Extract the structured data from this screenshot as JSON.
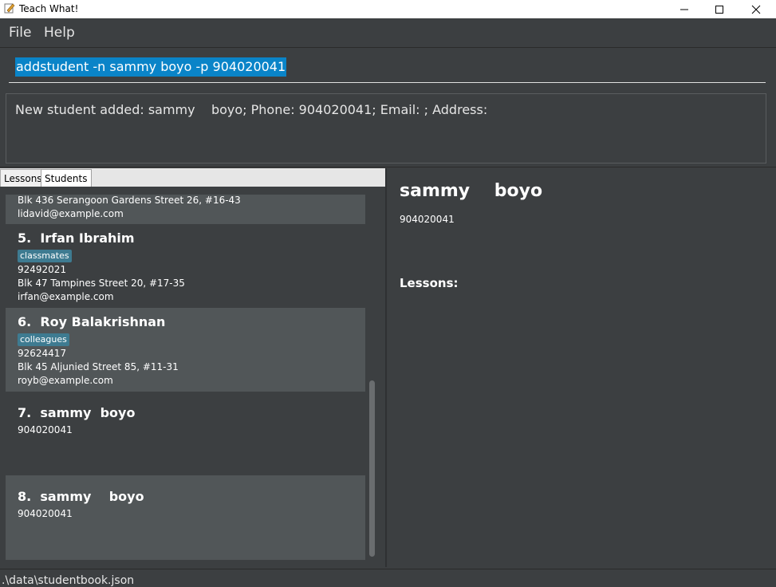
{
  "window": {
    "title": "Teach What!"
  },
  "menu": {
    "file": "File",
    "help": "Help"
  },
  "command": {
    "value": "addstudent -n sammy  boyo -p 904020041"
  },
  "result": {
    "text": "New student added: sammy    boyo; Phone: 904020041; Email: ; Address:"
  },
  "tabs": {
    "lessons": "Lessons",
    "students": "Students"
  },
  "students": [
    {
      "address": "Blk 436 Serangoon Gardens Street 26, #16-43",
      "email": "lidavid@example.com"
    },
    {
      "name": "5.  Irfan Ibrahim",
      "tag": "classmates",
      "phone": "92492021",
      "address": "Blk 47 Tampines Street 20, #17-35",
      "email": "irfan@example.com"
    },
    {
      "name": "6.  Roy Balakrishnan",
      "tag": "colleagues",
      "phone": "92624417",
      "address": "Blk 45 Aljunied Street 85, #11-31",
      "email": "royb@example.com"
    },
    {
      "name": "7.  sammy  boyo",
      "phone": "904020041"
    },
    {
      "name": "8.  sammy    boyo",
      "phone": "904020041"
    }
  ],
  "detail": {
    "name": "sammy    boyo",
    "phone": "904020041",
    "lessons_label": "Lessons:"
  },
  "status": {
    "path": ".\\data\\studentbook.json"
  },
  "colors": {
    "selection": "#0a84c8",
    "tag": "#3e7b91",
    "card_alt": "#515658",
    "background": "#3c3f41"
  },
  "icons": {
    "app": "notepad-pencil-icon",
    "minimize": "minimize-icon",
    "maximize": "maximize-icon",
    "close": "close-icon"
  }
}
